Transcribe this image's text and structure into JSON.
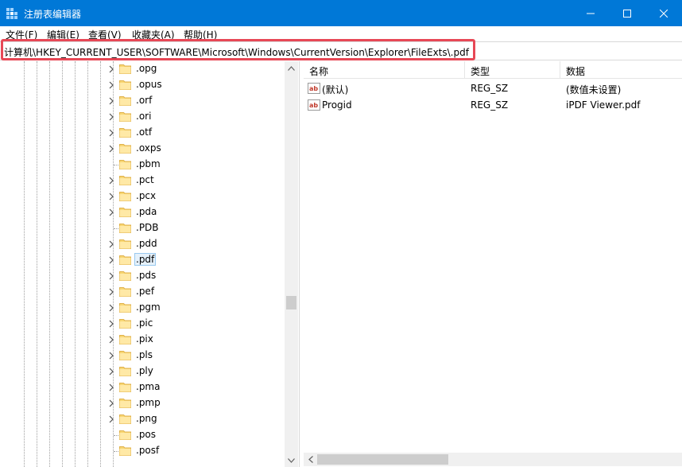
{
  "window": {
    "title": "注册表编辑器",
    "accent_color": "#0078d7"
  },
  "menu": {
    "items": [
      "文件(F)",
      "编辑(E)",
      "查看(V)",
      "收藏夹(A)",
      "帮助(H)"
    ]
  },
  "address": {
    "path": "计算机\\HKEY_CURRENT_USER\\SOFTWARE\\Microsoft\\Windows\\CurrentVersion\\Explorer\\FileExts\\.pdf",
    "highlight_color": "#e74856"
  },
  "tree": {
    "items": [
      {
        "label": ".opg",
        "expandable": true,
        "selected": false
      },
      {
        "label": ".opus",
        "expandable": true,
        "selected": false
      },
      {
        "label": ".orf",
        "expandable": true,
        "selected": false
      },
      {
        "label": ".ori",
        "expandable": true,
        "selected": false
      },
      {
        "label": ".otf",
        "expandable": true,
        "selected": false
      },
      {
        "label": ".oxps",
        "expandable": true,
        "selected": false
      },
      {
        "label": ".pbm",
        "expandable": false,
        "selected": false
      },
      {
        "label": ".pct",
        "expandable": true,
        "selected": false
      },
      {
        "label": ".pcx",
        "expandable": true,
        "selected": false
      },
      {
        "label": ".pda",
        "expandable": true,
        "selected": false
      },
      {
        "label": ".PDB",
        "expandable": false,
        "selected": false
      },
      {
        "label": ".pdd",
        "expandable": true,
        "selected": false
      },
      {
        "label": ".pdf",
        "expandable": true,
        "selected": true
      },
      {
        "label": ".pds",
        "expandable": true,
        "selected": false
      },
      {
        "label": ".pef",
        "expandable": true,
        "selected": false
      },
      {
        "label": ".pgm",
        "expandable": true,
        "selected": false
      },
      {
        "label": ".pic",
        "expandable": true,
        "selected": false
      },
      {
        "label": ".pix",
        "expandable": true,
        "selected": false
      },
      {
        "label": ".pls",
        "expandable": true,
        "selected": false
      },
      {
        "label": ".ply",
        "expandable": true,
        "selected": false
      },
      {
        "label": ".pma",
        "expandable": true,
        "selected": false
      },
      {
        "label": ".pmp",
        "expandable": true,
        "selected": false
      },
      {
        "label": ".png",
        "expandable": true,
        "selected": false
      },
      {
        "label": ".pos",
        "expandable": false,
        "selected": false
      },
      {
        "label": ".posf",
        "expandable": false,
        "selected": false
      }
    ]
  },
  "values": {
    "columns": {
      "name": "名称",
      "type": "类型",
      "data": "数据"
    },
    "rows": [
      {
        "name": "(默认)",
        "type": "REG_SZ",
        "data": "(数值未设置)",
        "icon": "string-value-icon"
      },
      {
        "name": "Progid",
        "type": "REG_SZ",
        "data": "iPDF Viewer.pdf",
        "icon": "string-value-icon"
      }
    ]
  }
}
